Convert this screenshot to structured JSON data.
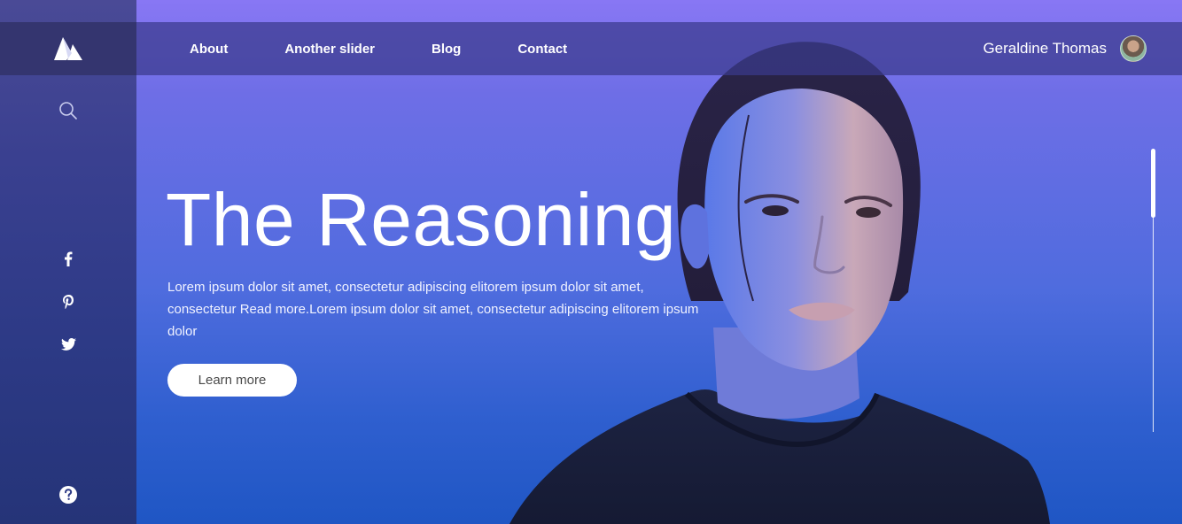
{
  "sidebar": {
    "logo_icon": "mountain-logo-icon",
    "search_icon": "search-icon",
    "social": [
      "facebook-icon",
      "pinterest-icon",
      "twitter-icon"
    ],
    "help_icon": "help-icon"
  },
  "nav": {
    "items": [
      "About",
      "Another slider",
      "Blog",
      "Contact"
    ]
  },
  "user": {
    "name": "Geraldine Thomas"
  },
  "hero": {
    "title": "The Reasoning",
    "text": "Lorem ipsum dolor sit amet, consectetur adipiscing elitorem ipsum dolor sit amet, consectetur Read more.Lorem ipsum dolor sit amet, consectetur adipiscing elitorem ipsum dolor",
    "button_label": "Learn more"
  },
  "colors": {
    "accent_top": "#8877f4",
    "accent_bottom": "#1f56c4",
    "sidebar": "#2d3a86"
  }
}
